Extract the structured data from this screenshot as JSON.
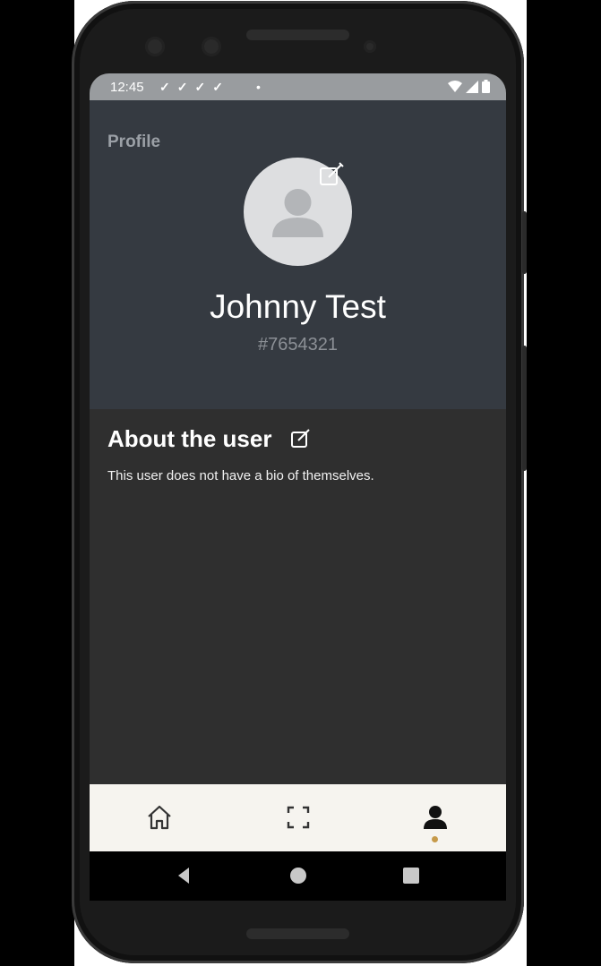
{
  "status_bar": {
    "time": "12:45",
    "checks": "✓✓✓✓",
    "dot": "•"
  },
  "profile": {
    "title": "Profile",
    "name": "Johnny Test",
    "user_id": "#7654321"
  },
  "about": {
    "title": "About the user",
    "bio": "This user does not have a bio of themselves."
  },
  "tabs": [
    {
      "icon": "home-icon",
      "active": false
    },
    {
      "icon": "scan-icon",
      "active": false
    },
    {
      "icon": "person-icon",
      "active": true
    }
  ],
  "colors": {
    "header_bg": "#353a41",
    "body_bg": "#2f2f2f",
    "tabbar_bg": "#f6f4ef",
    "active_dot": "#c69a4a"
  }
}
